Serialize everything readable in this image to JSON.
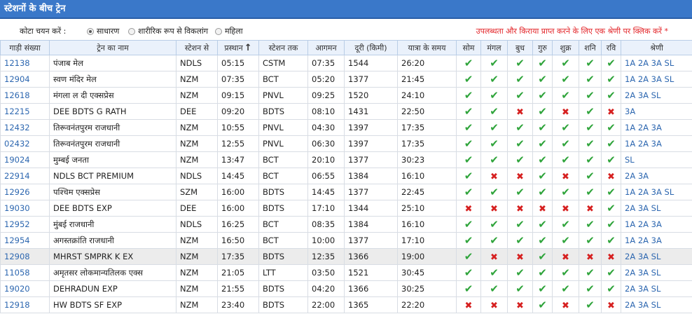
{
  "title": "स्टेशनों के बीच ट्रेन",
  "quota": {
    "label": "कोटा चयन करें :",
    "options": [
      "साधारण",
      "शारीरिक रूप से विकलांग",
      "महिला"
    ],
    "selected": 0
  },
  "note": "उपलब्धता और किराया प्राप्त करने के लिए एक श्रेणी पर क्लिक करें *",
  "columns": [
    "गाड़ी संख्या",
    "ट्रेन का नाम",
    "स्टेशन से",
    "प्रस्थान",
    "स्टेशन तक",
    "आगमन",
    "दूरी (किमी)",
    "यात्रा के समय",
    "सोम",
    "मंगल",
    "बुध",
    "गुरु",
    "शुक्र",
    "शनि",
    "रवि",
    "श्रेणी"
  ],
  "sort_icon": "arrow-up-icon",
  "day_icons": {
    "yes": "check-icon",
    "no": "cross-icon"
  },
  "colors": {
    "header": "#3a78c9",
    "link": "#2d67b0",
    "yes": "#2fa43b",
    "no": "#d62020",
    "note": "#e3262a",
    "highlight_row": "#ececec"
  },
  "highlighted_row": 12,
  "trains": [
    {
      "no": "12138",
      "name": "पंजाब मेल",
      "from": "NDLS",
      "dep": "05:15",
      "to": "CSTM",
      "arr": "07:35",
      "dist": "1544",
      "time": "26:20",
      "days": [
        1,
        1,
        1,
        1,
        1,
        1,
        1
      ],
      "classes": "1A 2A 3A SL"
    },
    {
      "no": "12904",
      "name": "स्वण मंदिर मेल",
      "from": "NZM",
      "dep": "07:35",
      "to": "BCT",
      "arr": "05:20",
      "dist": "1377",
      "time": "21:45",
      "days": [
        1,
        1,
        1,
        1,
        1,
        1,
        1
      ],
      "classes": "1A 2A 3A SL"
    },
    {
      "no": "12618",
      "name": "मंगला ल दी एक्सप्रेस",
      "from": "NZM",
      "dep": "09:15",
      "to": "PNVL",
      "arr": "09:25",
      "dist": "1520",
      "time": "24:10",
      "days": [
        1,
        1,
        1,
        1,
        1,
        1,
        1
      ],
      "classes": "2A 3A SL"
    },
    {
      "no": "12215",
      "name": "DEE BDTS G RATH",
      "from": "DEE",
      "dep": "09:20",
      "to": "BDTS",
      "arr": "08:10",
      "dist": "1431",
      "time": "22:50",
      "days": [
        1,
        1,
        0,
        1,
        0,
        1,
        0
      ],
      "classes": "3A"
    },
    {
      "no": "12432",
      "name": "तिरूवनंतपुरम राजधानी",
      "from": "NZM",
      "dep": "10:55",
      "to": "PNVL",
      "arr": "04:30",
      "dist": "1397",
      "time": "17:35",
      "days": [
        1,
        1,
        1,
        1,
        1,
        1,
        1
      ],
      "classes": "1A 2A 3A"
    },
    {
      "no": "02432",
      "name": "तिरूवनंतपुरम राजधानी",
      "from": "NZM",
      "dep": "12:55",
      "to": "PNVL",
      "arr": "06:30",
      "dist": "1397",
      "time": "17:35",
      "days": [
        1,
        1,
        1,
        1,
        1,
        1,
        1
      ],
      "classes": "1A 2A 3A"
    },
    {
      "no": "19024",
      "name": "मुम्बई जनता",
      "from": "NZM",
      "dep": "13:47",
      "to": "BCT",
      "arr": "20:10",
      "dist": "1377",
      "time": "30:23",
      "days": [
        1,
        1,
        1,
        1,
        1,
        1,
        1
      ],
      "classes": "SL"
    },
    {
      "no": "22914",
      "name": "NDLS BCT PREMIUM",
      "from": "NDLS",
      "dep": "14:45",
      "to": "BCT",
      "arr": "06:55",
      "dist": "1384",
      "time": "16:10",
      "days": [
        1,
        0,
        0,
        1,
        0,
        1,
        0
      ],
      "classes": "2A 3A"
    },
    {
      "no": "12926",
      "name": "पश्चिम एक्सप्रेस",
      "from": "SZM",
      "dep": "16:00",
      "to": "BDTS",
      "arr": "14:45",
      "dist": "1377",
      "time": "22:45",
      "days": [
        1,
        1,
        1,
        1,
        1,
        1,
        1
      ],
      "classes": "1A 2A 3A SL"
    },
    {
      "no": "19030",
      "name": "DEE BDTS EXP",
      "from": "DEE",
      "dep": "16:00",
      "to": "BDTS",
      "arr": "17:10",
      "dist": "1344",
      "time": "25:10",
      "days": [
        0,
        0,
        0,
        0,
        0,
        0,
        1
      ],
      "classes": "2A 3A SL"
    },
    {
      "no": "12952",
      "name": "मुंबई राजधानी",
      "from": "NDLS",
      "dep": "16:25",
      "to": "BCT",
      "arr": "08:35",
      "dist": "1384",
      "time": "16:10",
      "days": [
        1,
        1,
        1,
        1,
        1,
        1,
        1
      ],
      "classes": "1A 2A 3A"
    },
    {
      "no": "12954",
      "name": "अगस्तक्रांति राजधानी",
      "from": "NZM",
      "dep": "16:50",
      "to": "BCT",
      "arr": "10:00",
      "dist": "1377",
      "time": "17:10",
      "days": [
        1,
        1,
        1,
        1,
        1,
        1,
        1
      ],
      "classes": "1A 2A 3A"
    },
    {
      "no": "12908",
      "name": "MHRST SMPRK K EX",
      "from": "NZM",
      "dep": "17:35",
      "to": "BDTS",
      "arr": "12:35",
      "dist": "1366",
      "time": "19:00",
      "days": [
        1,
        0,
        0,
        1,
        0,
        0,
        0
      ],
      "classes": "2A 3A SL"
    },
    {
      "no": "11058",
      "name": "अमृतसर लोकमान्यतिलक एक्स",
      "from": "NZM",
      "dep": "21:05",
      "to": "LTT",
      "arr": "03:50",
      "dist": "1521",
      "time": "30:45",
      "days": [
        1,
        1,
        1,
        1,
        1,
        1,
        1
      ],
      "classes": "2A 3A SL"
    },
    {
      "no": "19020",
      "name": "DEHRADUN EXP",
      "from": "NZM",
      "dep": "21:55",
      "to": "BDTS",
      "arr": "04:20",
      "dist": "1366",
      "time": "30:25",
      "days": [
        1,
        1,
        1,
        1,
        1,
        1,
        1
      ],
      "classes": "2A 3A SL"
    },
    {
      "no": "12918",
      "name": "HW BDTS SF EXP",
      "from": "NZM",
      "dep": "23:40",
      "to": "BDTS",
      "arr": "22:00",
      "dist": "1365",
      "time": "22:20",
      "days": [
        0,
        0,
        0,
        1,
        0,
        1,
        0
      ],
      "classes": "2A 3A SL"
    }
  ]
}
